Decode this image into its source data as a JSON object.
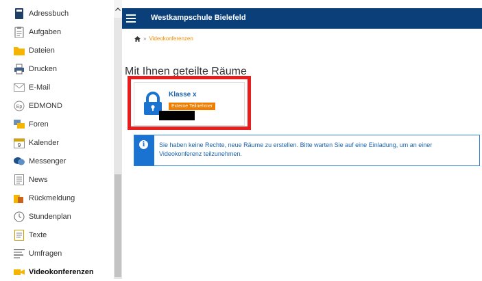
{
  "sidebar": {
    "items": [
      {
        "label": "Adressbuch",
        "icon": "address-book-icon"
      },
      {
        "label": "Aufgaben",
        "icon": "clipboard-icon"
      },
      {
        "label": "Dateien",
        "icon": "folder-icon"
      },
      {
        "label": "Drucken",
        "icon": "printer-icon"
      },
      {
        "label": "E-Mail",
        "icon": "envelope-icon"
      },
      {
        "label": "EDMOND",
        "icon": "edmond-icon"
      },
      {
        "label": "Foren",
        "icon": "forum-icon"
      },
      {
        "label": "Kalender",
        "icon": "calendar-icon"
      },
      {
        "label": "Messenger",
        "icon": "chat-icon"
      },
      {
        "label": "News",
        "icon": "newspaper-icon"
      },
      {
        "label": "Rückmeldung",
        "icon": "feedback-icon"
      },
      {
        "label": "Stundenplan",
        "icon": "clock-icon"
      },
      {
        "label": "Texte",
        "icon": "text-document-icon"
      },
      {
        "label": "Umfragen",
        "icon": "poll-icon"
      },
      {
        "label": "Videokonferenzen",
        "icon": "video-camera-icon",
        "active": true
      }
    ],
    "calendar_day": "9",
    "edmond_glyph": "Ep"
  },
  "header": {
    "title": "Westkampschule Bielefeld"
  },
  "breadcrumb": {
    "home_icon": "home-icon",
    "separator": "»",
    "current": "Videokonferenzen"
  },
  "main": {
    "heading": "Mit Ihnen geteilte Räume",
    "room": {
      "name": "Klasse x",
      "badge": "Externe Teilnehmer",
      "icon": "lock-icon"
    },
    "info": {
      "icon": "info-icon",
      "glyph": "i",
      "text": "Sie haben keine Rechte, neue Räume zu erstellen. Bitte warten Sie auf eine Einladung, um an einer Videokonferenz teilzunehmen."
    }
  },
  "colors": {
    "header_bg": "#0b3f7a",
    "accent_orange": "#ef7d00",
    "link_blue": "#1a63ae",
    "info_blue": "#1a73d0",
    "highlight_red": "#e61e1e"
  }
}
